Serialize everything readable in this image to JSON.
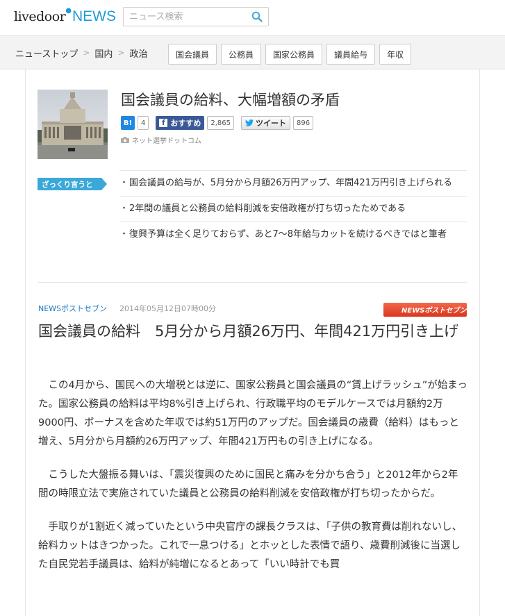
{
  "header": {
    "logo_text": "livedoor",
    "logo_news": "NEWS",
    "search_placeholder": "ニュース検索"
  },
  "breadcrumb": [
    "ニューストップ",
    "国内",
    "政治"
  ],
  "tags": [
    "国会議員",
    "公務員",
    "国家公務員",
    "議員給与",
    "年収"
  ],
  "article_head": {
    "headline": "国会議員の給料、大幅増額の矛盾",
    "hatena_label": "B!",
    "hatena_count": "4",
    "fb_label": "おすすめ",
    "fb_count": "2,865",
    "tw_label": "ツイート",
    "tw_count": "896",
    "source": "ネット選挙ドットコム"
  },
  "zakkuri": {
    "label": "ざっくり言うと",
    "items": [
      "国会議員の給与が、5月分から月額26万円アップ、年間421万円引き上げられる",
      "2年間の議員と公務員の給料削減を安倍政権が打ち切ったためである",
      "復興予算は全く足りておらず、あと7〜8年給与カットを続けるべきではと筆者"
    ]
  },
  "article": {
    "publisher": "NEWSポストセブン",
    "date": "2014年05月12日07時00分",
    "pub_logo_text": "NEWSポストセブン",
    "title": "国会議員の給料　5月分から月額26万円、年間421万円引き上げ",
    "paragraphs": [
      "この4月から、国民への大増税とは逆に、国家公務員と国会議員の“賃上げラッシュ”が始まった。国家公務員の給料は平均8%引き上げられ、行政職平均のモデルケースでは月額約2万9000円、ボーナスを含めた年収では約51万円のアップだ。国会議員の歳費（給料）はもっと増え、5月分から月額約26万円アップ、年間421万円もの引き上げになる。",
      "こうした大盤振る舞いは、「震災復興のために国民と痛みを分かち合う」と2012年から2年間の時限立法で実施されていた議員と公務員の給料削減を安倍政権が打ち切ったからだ。",
      "手取りが1割近く減っていたという中央官庁の課長クラスは、「子供の教育費は削れないし、給料カットはきつかった。これで一息つける」とホッとした表情で語り、歳費削減後に当選した自民党若手議員は、給料が純増になるとあって「いい時計でも買"
    ]
  },
  "colors": {
    "brand_blue": "#1e9bd7",
    "zakkuri_badge": "#3aa8d8",
    "publisher_link": "#1e7ac2",
    "pub_logo_red": "#e8452a"
  }
}
